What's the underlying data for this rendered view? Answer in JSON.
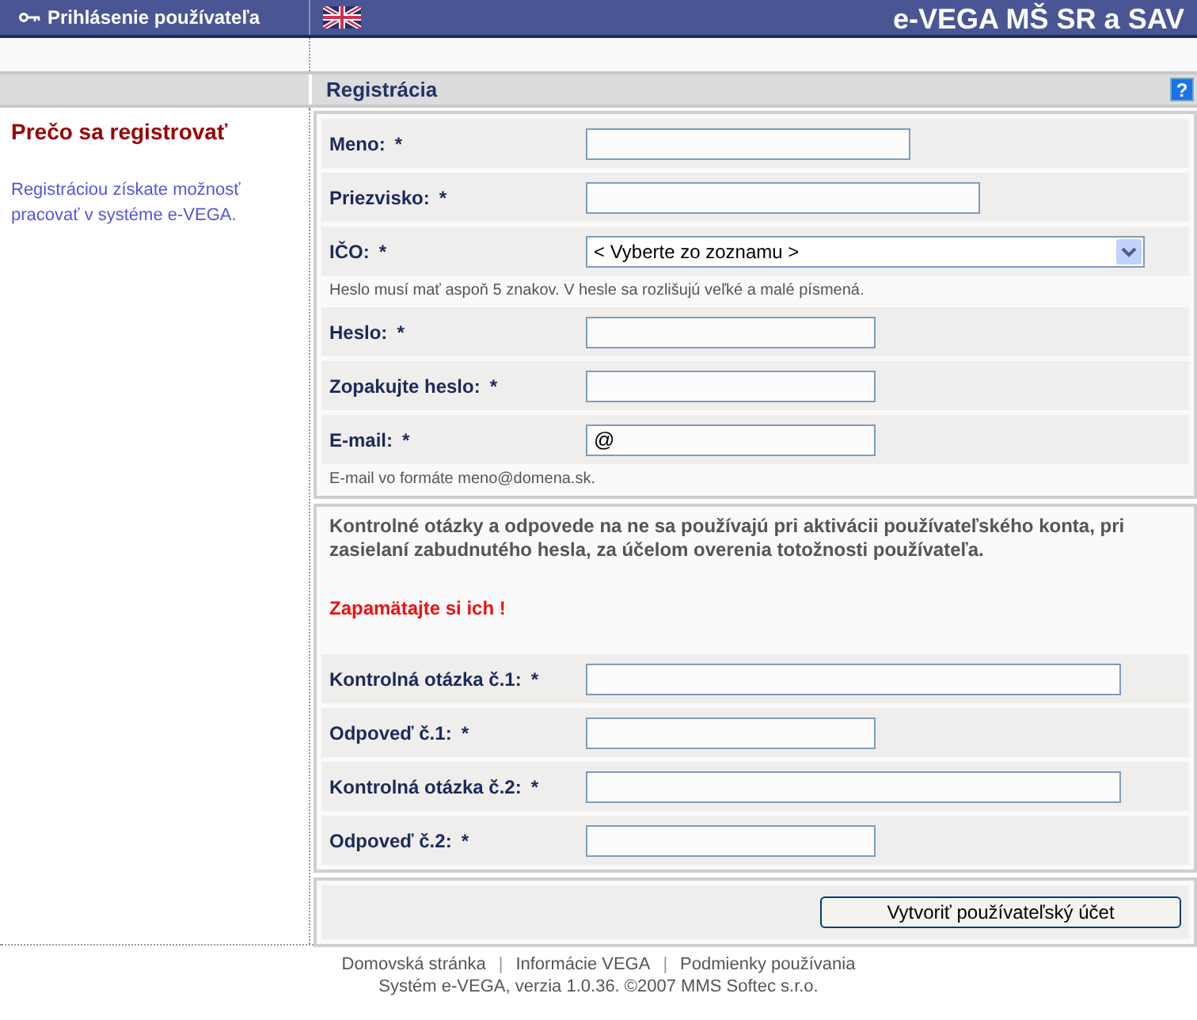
{
  "header": {
    "login_link": "Prihlásenie používateľa",
    "title": "e-VEGA MŠ SR a SAV"
  },
  "section": {
    "title": "Registrácia",
    "help": "?"
  },
  "sidebar": {
    "heading": "Prečo sa registrovať",
    "text": "Registráciou získate možnosť pracovať v systéme e-VEGA."
  },
  "form_groups": [
    {
      "items": [
        {
          "kind": "input",
          "label": "Meno:",
          "mark": "*"
        },
        {
          "kind": "input",
          "label": "Priezvisko:",
          "mark": "*"
        },
        {
          "kind": "select",
          "label": "IČO:",
          "mark": "*",
          "value": "< Vyberte zo zoznamu >"
        },
        {
          "kind": "hint",
          "text": "Heslo musí mať aspoň 5 znakov. V hesle sa rozlišujú veľké a malé písmená."
        },
        {
          "kind": "input",
          "label": "Heslo:",
          "mark": "*"
        },
        {
          "kind": "input",
          "label": "Zopakujte heslo:",
          "mark": "*"
        },
        {
          "kind": "input",
          "label": "E-mail:",
          "mark": "*",
          "value": "@"
        },
        {
          "kind": "hint",
          "text": "E-mail vo formáte meno@domena.sk."
        }
      ]
    },
    {
      "items": [
        {
          "kind": "info",
          "text": "Kontrolné otázky a odpovede na ne sa používajú pri aktivácii používateľského konta, pri zasielaní zabudnutého hesla, za účelom overenia totožnosti používateľa."
        },
        {
          "kind": "warning",
          "text": "Zapamätajte si ich !"
        },
        {
          "kind": "input",
          "label": "Kontrolná otázka č.1:",
          "mark": "*"
        },
        {
          "kind": "input",
          "label": "Odpoveď č.1:",
          "mark": "*"
        },
        {
          "kind": "input",
          "label": "Kontrolná otázka č.2:",
          "mark": "*"
        },
        {
          "kind": "input",
          "label": "Odpoveď č.2:",
          "mark": "*"
        }
      ]
    }
  ],
  "submit_button": "Vytvoriť používateľský účet",
  "footer": {
    "links": [
      "Domovská stránka",
      "Informácie VEGA",
      "Podmienky používania"
    ],
    "separators": [
      "|",
      "|"
    ],
    "copyright": "Systém e-VEGA, verzia 1.0.36. ©2007 MMS Softec s.r.o."
  }
}
